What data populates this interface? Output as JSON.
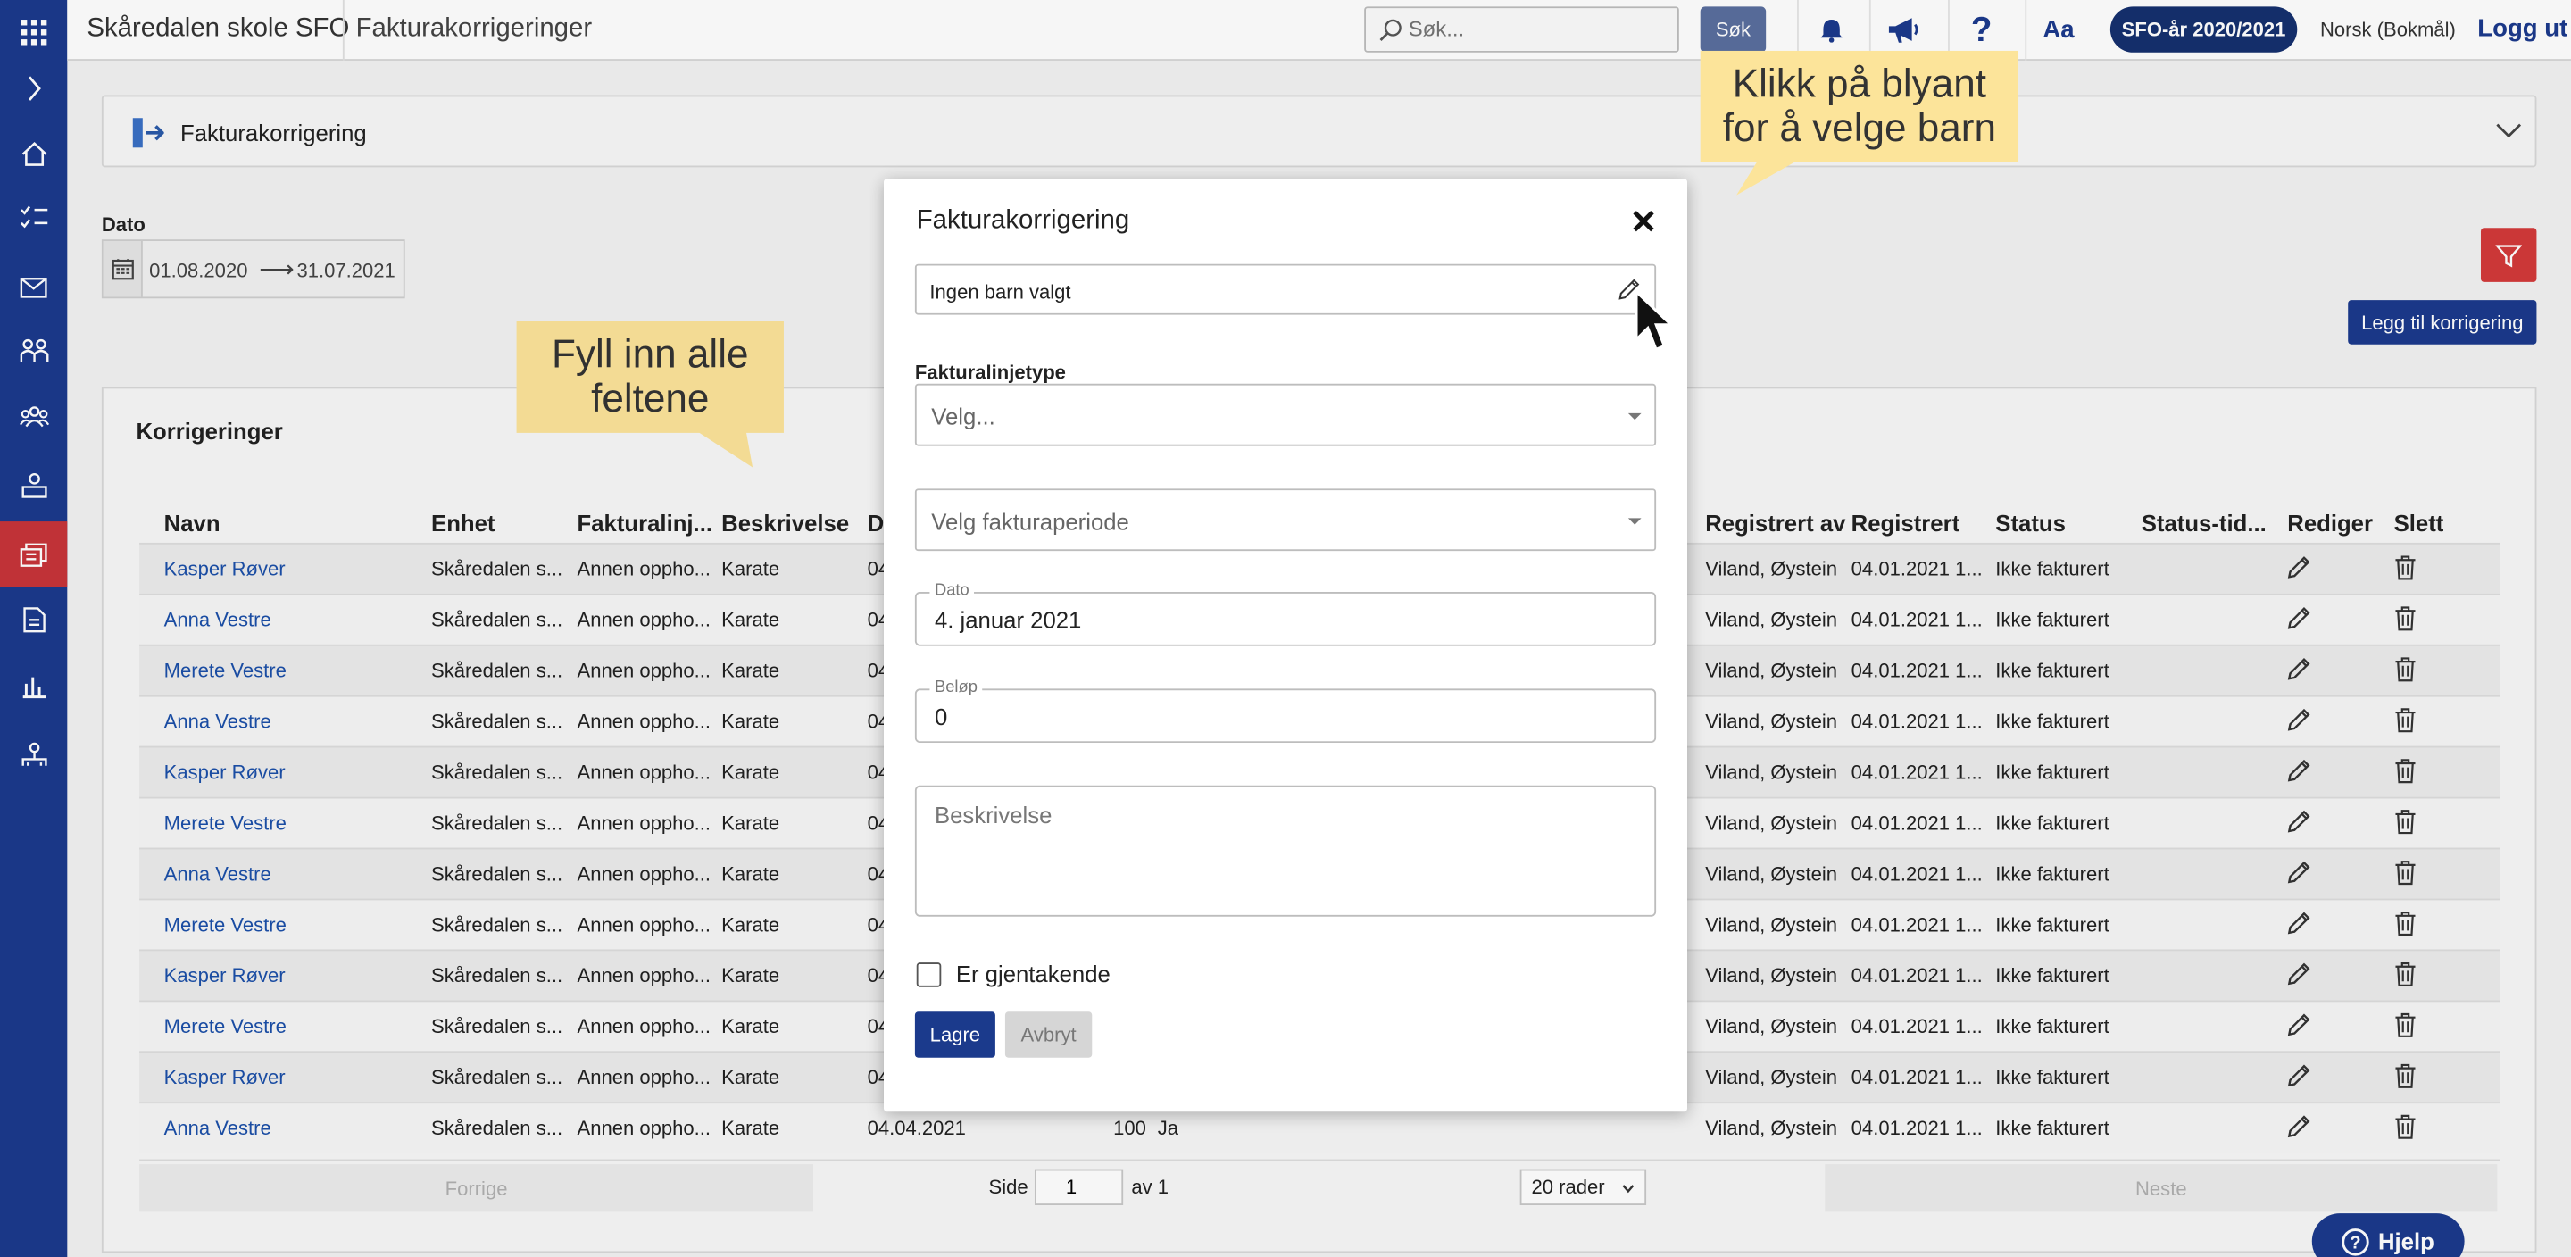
{
  "topbar": {
    "school": "Skåredalen skole SFO",
    "page": "Fakturakorrigeringer",
    "search_placeholder": "Søk...",
    "search_button": "Søk",
    "font_toggle": "Aa",
    "sfo_year": "SFO-år 2020/2021",
    "language": "Norsk (Bokmål)",
    "logout": "Logg ut"
  },
  "header": {
    "title": "Fakturakorrigering"
  },
  "filter": {
    "date_label": "Dato",
    "from": "01.08.2020",
    "to": "31.07.2021"
  },
  "add_button": "Legg til korrigering",
  "table": {
    "title": "Korrigeringer",
    "columns": [
      "Navn",
      "Enhet",
      "Fakturalinj...",
      "Beskrivelse",
      "D",
      "Registrert av",
      "Registrert",
      "Status",
      "Status-tid...",
      "Rediger",
      "Slett"
    ],
    "rows": [
      {
        "name": "Kasper Røver",
        "unit": "Skåredalen s...",
        "type": "Annen oppho...",
        "desc": "Karate",
        "date": "04",
        "amount": "",
        "recurring": "",
        "by": "Viland, Øystein",
        "reg": "04.01.2021 1...",
        "status": "Ikke fakturert"
      },
      {
        "name": "Anna Vestre",
        "unit": "Skåredalen s...",
        "type": "Annen oppho...",
        "desc": "Karate",
        "date": "04",
        "amount": "",
        "recurring": "",
        "by": "Viland, Øystein",
        "reg": "04.01.2021 1...",
        "status": "Ikke fakturert"
      },
      {
        "name": "Merete Vestre",
        "unit": "Skåredalen s...",
        "type": "Annen oppho...",
        "desc": "Karate",
        "date": "04",
        "amount": "",
        "recurring": "",
        "by": "Viland, Øystein",
        "reg": "04.01.2021 1...",
        "status": "Ikke fakturert"
      },
      {
        "name": "Anna Vestre",
        "unit": "Skåredalen s...",
        "type": "Annen oppho...",
        "desc": "Karate",
        "date": "04",
        "amount": "",
        "recurring": "",
        "by": "Viland, Øystein",
        "reg": "04.01.2021 1...",
        "status": "Ikke fakturert"
      },
      {
        "name": "Kasper Røver",
        "unit": "Skåredalen s...",
        "type": "Annen oppho...",
        "desc": "Karate",
        "date": "04",
        "amount": "",
        "recurring": "",
        "by": "Viland, Øystein",
        "reg": "04.01.2021 1...",
        "status": "Ikke fakturert"
      },
      {
        "name": "Merete Vestre",
        "unit": "Skåredalen s...",
        "type": "Annen oppho...",
        "desc": "Karate",
        "date": "04",
        "amount": "",
        "recurring": "",
        "by": "Viland, Øystein",
        "reg": "04.01.2021 1...",
        "status": "Ikke fakturert"
      },
      {
        "name": "Anna Vestre",
        "unit": "Skåredalen s...",
        "type": "Annen oppho...",
        "desc": "Karate",
        "date": "04",
        "amount": "",
        "recurring": "",
        "by": "Viland, Øystein",
        "reg": "04.01.2021 1...",
        "status": "Ikke fakturert"
      },
      {
        "name": "Merete Vestre",
        "unit": "Skåredalen s...",
        "type": "Annen oppho...",
        "desc": "Karate",
        "date": "04",
        "amount": "",
        "recurring": "",
        "by": "Viland, Øystein",
        "reg": "04.01.2021 1...",
        "status": "Ikke fakturert"
      },
      {
        "name": "Kasper Røver",
        "unit": "Skåredalen s...",
        "type": "Annen oppho...",
        "desc": "Karate",
        "date": "04",
        "amount": "",
        "recurring": "",
        "by": "Viland, Øystein",
        "reg": "04.01.2021 1...",
        "status": "Ikke fakturert"
      },
      {
        "name": "Merete Vestre",
        "unit": "Skåredalen s...",
        "type": "Annen oppho...",
        "desc": "Karate",
        "date": "04",
        "amount": "",
        "recurring": "",
        "by": "Viland, Øystein",
        "reg": "04.01.2021 1...",
        "status": "Ikke fakturert"
      },
      {
        "name": "Kasper Røver",
        "unit": "Skåredalen s...",
        "type": "Annen oppho...",
        "desc": "Karate",
        "date": "04",
        "amount": "",
        "recurring": "",
        "by": "Viland, Øystein",
        "reg": "04.01.2021 1...",
        "status": "Ikke fakturert"
      },
      {
        "name": "Anna Vestre",
        "unit": "Skåredalen s...",
        "type": "Annen oppho...",
        "desc": "Karate",
        "date": "04.04.2021",
        "amount": "100",
        "recurring": "Ja",
        "by": "Viland, Øystein",
        "reg": "04.01.2021 1...",
        "status": "Ikke fakturert"
      }
    ]
  },
  "pager": {
    "prev": "Forrige",
    "page_label": "Side",
    "page": "1",
    "of": "av 1",
    "rows": "20 rader",
    "next": "Neste"
  },
  "help": "Hjelp",
  "modal": {
    "title": "Fakturakorrigering",
    "child_field": "Ingen barn valgt",
    "line_type_label": "Fakturalinjetype",
    "line_type_placeholder": "Velg...",
    "period_placeholder": "Velg fakturaperiode",
    "date_label": "Dato",
    "date_value": "4. januar 2021",
    "amount_label": "Beløp",
    "amount_value": "0",
    "desc_placeholder": "Beskrivelse",
    "recurring_label": "Er gjentakende",
    "save": "Lagre",
    "cancel": "Avbryt"
  },
  "callouts": {
    "fill_line1": "Fyll inn alle",
    "fill_line2": "feltene",
    "pencil_line1": "Klikk på blyant",
    "pencil_line2": "for å velge barn"
  },
  "colors": {
    "nav": "#1b3a8c",
    "active_nav": "#c8343a",
    "callout": "#fce49a",
    "link": "#1b4fa8",
    "filter": "#d33a3a"
  }
}
